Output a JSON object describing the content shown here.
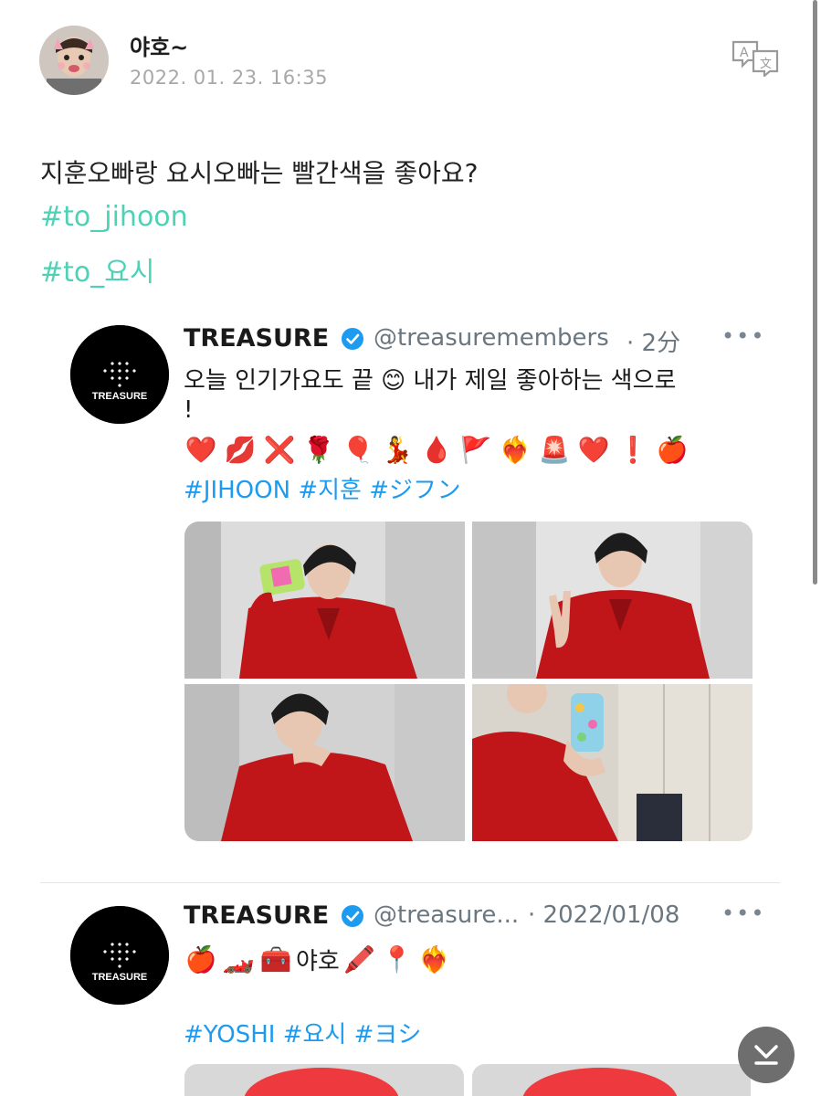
{
  "post": {
    "author": "야호~",
    "timestamp": "2022. 01. 23. 16:35",
    "text": "지훈오빠랑 요시오빠는 빨간색을 좋아요?",
    "hashtags": [
      "#to_jihoon",
      "#to_요시"
    ],
    "hashtag_color": "#4fd1b6"
  },
  "tweets": [
    {
      "name": "TREASURE",
      "handle": "@treasuremembers",
      "time": "· 2分",
      "text_line1": "오늘 인기가요도 끝 😊 내가 제일 좋아하는 색으로",
      "text_line2": "!",
      "emojis": [
        "❤️",
        "💋",
        "❌",
        "🌹",
        "🎈",
        "💃",
        "🩸",
        "🚩",
        "❤️‍🔥",
        "🚨",
        "❤️",
        "❗",
        "🍎"
      ],
      "tags": "#JIHOON #지훈 #ジフン",
      "avatar_label": "TREASURE"
    },
    {
      "name": "TREASURE",
      "handle": "@treasure...",
      "time": "· 2022/01/08",
      "text_line1": "야호",
      "emojis_before": [
        "🍎",
        "🏎️",
        "🧰"
      ],
      "emojis_after": [
        "🖍️",
        "📍",
        "❤️‍🔥"
      ],
      "tags": "#YOSHI #요시 #ヨシ",
      "avatar_label": "TREASURE"
    }
  ],
  "icons": {
    "translate": "translate-icon",
    "more": "more-icon",
    "verified": "verified-badge-icon",
    "scroll": "scroll-down-icon"
  },
  "colors": {
    "link": "#1d9bf0",
    "verified": "#1d9bf0",
    "outfit_red": "#c0161a"
  }
}
